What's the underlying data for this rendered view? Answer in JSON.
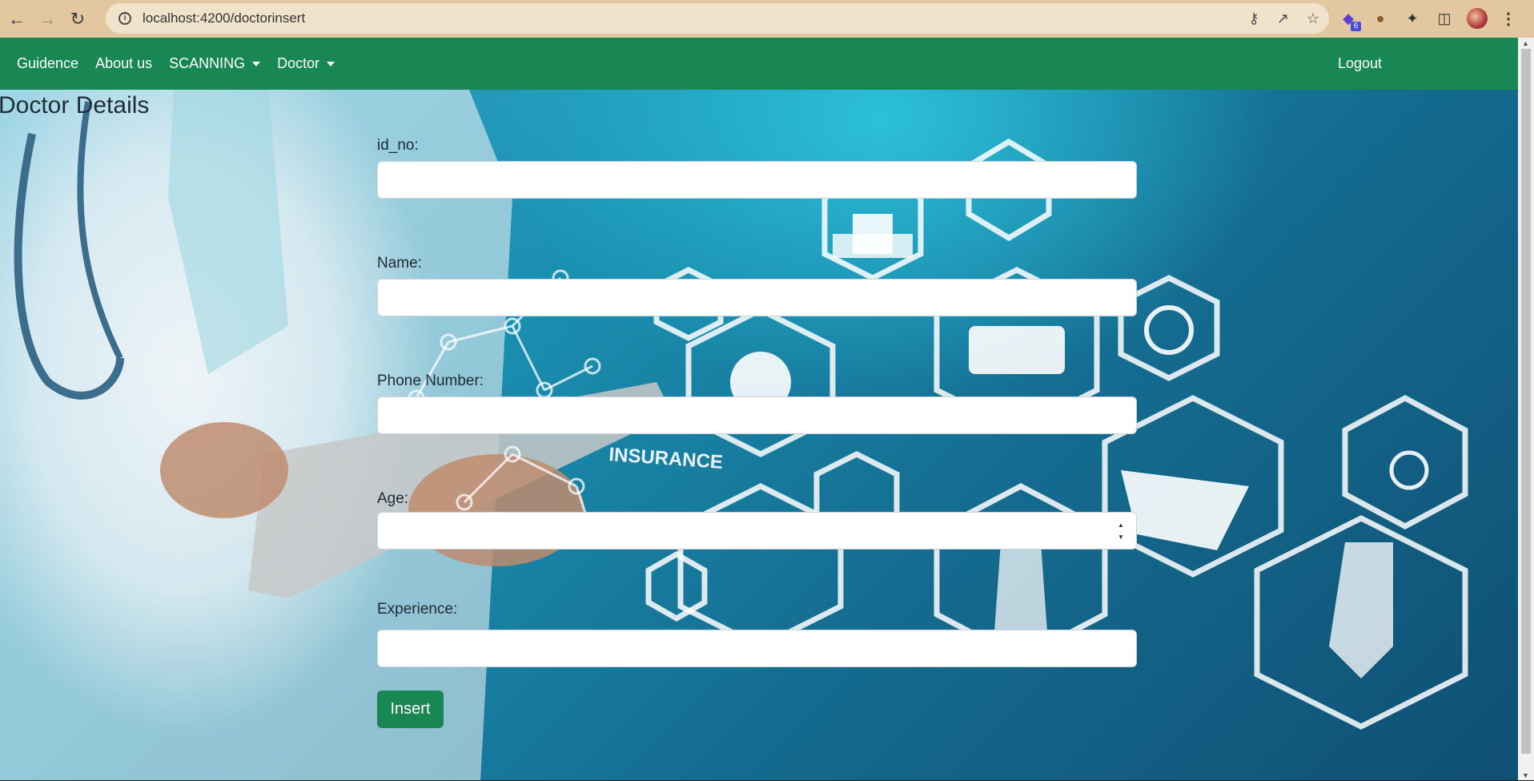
{
  "browser": {
    "url": "localhost:4200/doctorinsert",
    "extension_badge": "6"
  },
  "navbar": {
    "items": [
      {
        "label": "Guidence",
        "dropdown": false
      },
      {
        "label": "About us",
        "dropdown": false
      },
      {
        "label": "SCANNING",
        "dropdown": true
      },
      {
        "label": "Doctor",
        "dropdown": true
      }
    ],
    "logout_label": "Logout",
    "color": "#198754"
  },
  "page": {
    "title": "Doctor Details"
  },
  "form": {
    "fields": [
      {
        "label": "id_no:",
        "value": "",
        "type": "text"
      },
      {
        "label": "Name:",
        "value": "",
        "type": "text"
      },
      {
        "label": "Phone Number:",
        "value": "",
        "type": "text"
      },
      {
        "label": "Age:",
        "value": "",
        "type": "number"
      },
      {
        "label": "Experience:",
        "value": "",
        "type": "text"
      }
    ],
    "submit_label": "Insert"
  },
  "background": {
    "overlay_texts": [
      "INSURANCE"
    ]
  }
}
